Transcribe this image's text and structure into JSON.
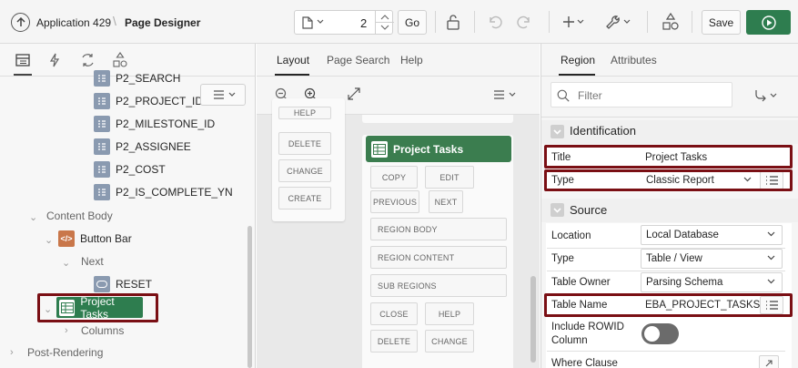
{
  "toolbar": {
    "app_label": "Application 429",
    "page_designer_label": "Page Designer",
    "page_number": "2",
    "go_label": "Go",
    "save_label": "Save"
  },
  "left": {
    "tabs": [
      "rendering-tab",
      "dynamic-actions-tab",
      "processing-tab",
      "shared-components-tab"
    ],
    "items": [
      {
        "label": "P2_SEARCH"
      },
      {
        "label": "P2_PROJECT_ID"
      },
      {
        "label": "P2_MILESTONE_ID"
      },
      {
        "label": "P2_ASSIGNEE"
      },
      {
        "label": "P2_COST"
      },
      {
        "label": "P2_IS_COMPLETE_YN"
      }
    ],
    "content_body": "Content Body",
    "button_bar": "Button Bar",
    "next": "Next",
    "reset": "RESET",
    "project_tasks": "Project Tasks",
    "columns": "Columns",
    "post_rendering": "Post-Rendering"
  },
  "center": {
    "tabs": [
      "Layout",
      "Page Search",
      "Help"
    ],
    "left_card_buttons": [
      "HELP",
      "DELETE",
      "CHANGE",
      "CREATE"
    ],
    "region_title": "Project Tasks",
    "region_buttons": {
      "copy": "COPY",
      "edit": "EDIT",
      "previous": "PREVIOUS",
      "next": "NEXT",
      "region_body": "REGION BODY",
      "region_content": "REGION CONTENT",
      "sub_regions": "SUB REGIONS",
      "close": "CLOSE",
      "help": "HELP",
      "delete": "DELETE",
      "change": "CHANGE"
    }
  },
  "right": {
    "tabs": [
      "Region",
      "Attributes"
    ],
    "filter_placeholder": "Filter",
    "identification": {
      "heading": "Identification",
      "title_label": "Title",
      "title_value": "Project Tasks",
      "type_label": "Type",
      "type_value": "Classic Report"
    },
    "source": {
      "heading": "Source",
      "location_label": "Location",
      "location_value": "Local Database",
      "type_label": "Type",
      "type_value": "Table / View",
      "owner_label": "Table Owner",
      "owner_value": "Parsing Schema",
      "table_name_label": "Table Name",
      "table_name_value": "EBA_PROJECT_TASKS",
      "rowid_label_1": "Include ROWID",
      "rowid_label_2": "Column",
      "where_label": "Where Clause"
    }
  },
  "colors": {
    "run_button": "#2e7d4f",
    "region_header": "#3b7d4f",
    "highlight": "#7a0f14",
    "accent_tab": "#262626"
  }
}
